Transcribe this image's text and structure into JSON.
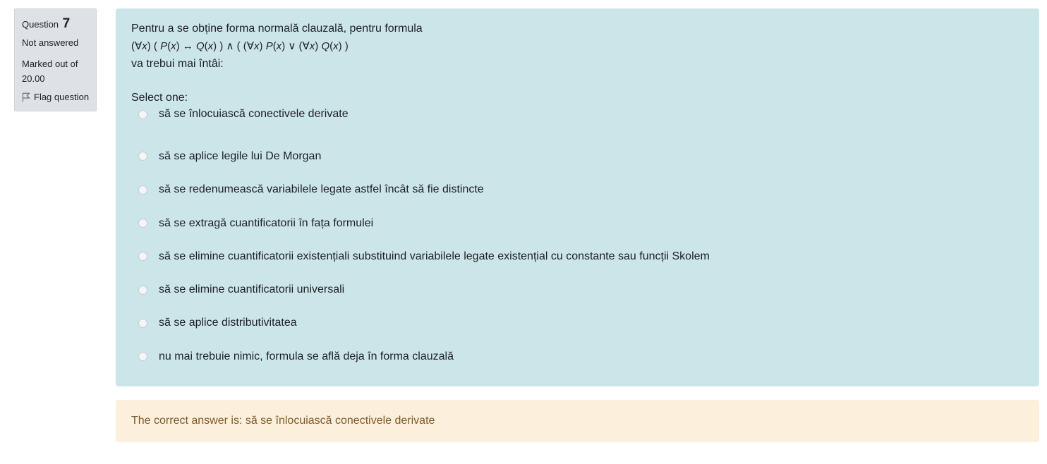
{
  "question_info": {
    "label": "Question",
    "number": "7",
    "state": "Not answered",
    "grade_line1": "Marked out of",
    "grade_line2": "20.00",
    "flag_label": "Flag question",
    "flag_icon": "flag-icon"
  },
  "question": {
    "text_line1": "Pentru a se obține forma normală clauzală, pentru formula",
    "formula": {
      "p1": "(∀",
      "x1": "x",
      "p2": ") ( ",
      "P1": "P",
      "p3": "(",
      "x2": "x",
      "p4": ") ↔ ",
      "Q1": "Q",
      "p5": "(",
      "x3": "x",
      "p6": ") ) ∧ ( (∀",
      "x4": "x",
      "p7": ") ",
      "P2": "P",
      "p8": "(",
      "x5": "x",
      "p9": ") ∨ (∀",
      "x6": "x",
      "p10": ") ",
      "Q2": "Q",
      "p11": "(",
      "x7": "x",
      "p12": ") )"
    },
    "text_line3": "va trebui mai întâi:",
    "prompt": "Select one:",
    "options": [
      {
        "label": "să se înlocuiască conectivele derivate"
      },
      {
        "label": "să se aplice legile lui De Morgan"
      },
      {
        "label": "să se redenumească variabilele legate astfel încât să fie distincte"
      },
      {
        "label": "să se extragă cuantificatorii în fața formulei"
      },
      {
        "label": "să se elimine cuantificatorii existențiali substituind variabilele legate existențial cu constante sau funcții Skolem"
      },
      {
        "label": "să se elimine cuantificatorii universali"
      },
      {
        "label": "să se aplice distributivitatea"
      },
      {
        "label": "nu mai trebuie nimic, formula se află deja în forma clauzală"
      }
    ]
  },
  "feedback": {
    "right_answer": "The correct answer is: să se înlocuiască conectivele derivate"
  },
  "colors": {
    "info_bg": "#dee2e6",
    "formulation_bg": "#cce5e9",
    "feedback_bg": "#fcefdc",
    "feedback_text": "#7d5a29"
  }
}
